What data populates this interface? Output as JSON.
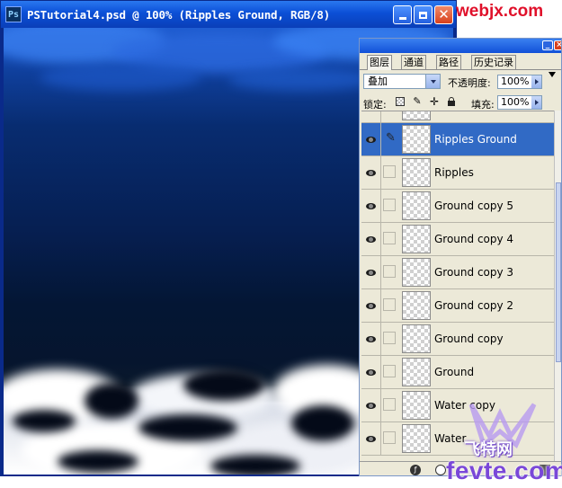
{
  "document": {
    "title": "PSTutorial4.psd @ 100% (Ripples Ground, RGB/8)",
    "app_icon": "Ps"
  },
  "watermarks": {
    "top": "webjx.com",
    "bottom_logo": "飞特网",
    "bottom_site": "fevte.com"
  },
  "layers_panel": {
    "tabs": [
      "图层",
      "通道",
      "路径",
      "历史记录"
    ],
    "active_tab": 0,
    "blend_mode": "叠加",
    "opacity_label": "不透明度:",
    "opacity_value": "100%",
    "lock_label": "锁定:",
    "fill_label": "填充:",
    "fill_value": "100%",
    "layers": [
      {
        "name": "",
        "visible": false,
        "selected": false,
        "partial": true
      },
      {
        "name": "Ripples Ground",
        "visible": true,
        "selected": true
      },
      {
        "name": "Ripples",
        "visible": true,
        "selected": false
      },
      {
        "name": "Ground copy 5",
        "visible": true,
        "selected": false
      },
      {
        "name": "Ground copy 4",
        "visible": true,
        "selected": false
      },
      {
        "name": "Ground copy 3",
        "visible": true,
        "selected": false
      },
      {
        "name": "Ground copy 2",
        "visible": true,
        "selected": false
      },
      {
        "name": "Ground copy",
        "visible": true,
        "selected": false
      },
      {
        "name": "Ground",
        "visible": true,
        "selected": false
      },
      {
        "name": "Water copy",
        "visible": true,
        "selected": false
      },
      {
        "name": "Water",
        "visible": true,
        "selected": false
      }
    ]
  },
  "colors": {
    "titlebar": "#0b4fd6",
    "selection": "#316ac5",
    "panel_bg": "#ece9d8",
    "watermark_red": "#e0102a",
    "watermark_purple": "#7a48d8"
  }
}
